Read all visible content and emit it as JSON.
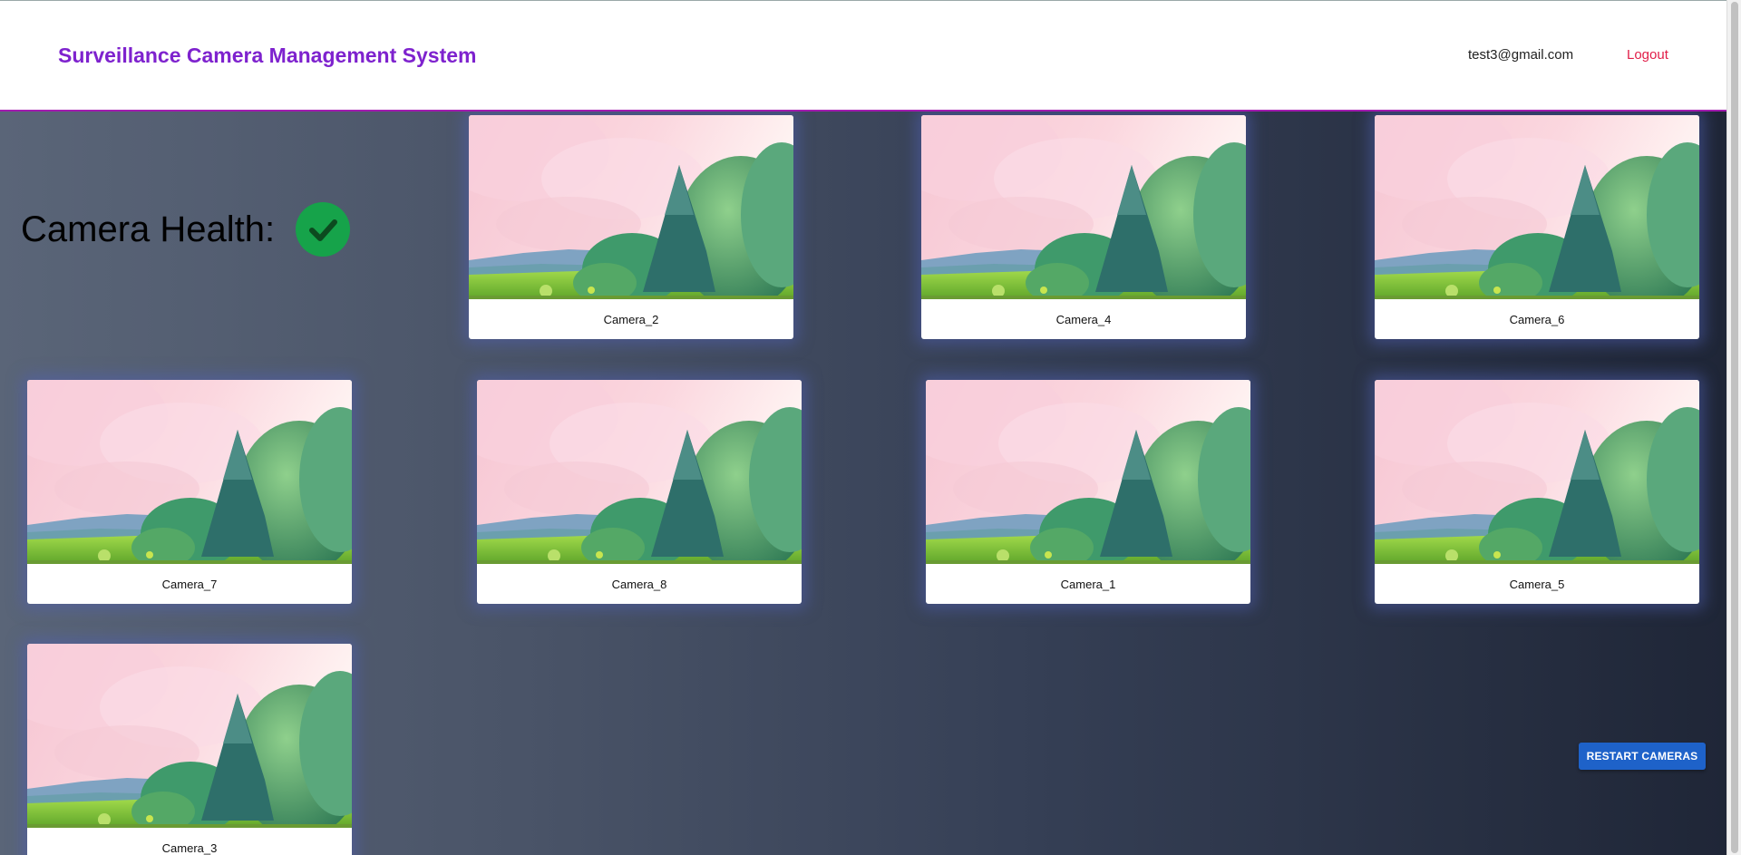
{
  "header": {
    "title": "Surveillance Camera Management System",
    "user_email": "test3@gmail.com",
    "logout_label": "Logout"
  },
  "health": {
    "label": "Camera Health:",
    "status_icon": "check-circle-icon",
    "status_color": "#16a34a"
  },
  "cameras": [
    {
      "name": "Camera_2"
    },
    {
      "name": "Camera_4"
    },
    {
      "name": "Camera_6"
    },
    {
      "name": "Camera_7"
    },
    {
      "name": "Camera_8"
    },
    {
      "name": "Camera_1"
    },
    {
      "name": "Camera_5"
    },
    {
      "name": "Camera_3"
    }
  ],
  "actions": {
    "restart_label": "RESTART CAMERAS"
  },
  "colors": {
    "brand": "#7e22ce",
    "logout": "#e11d48",
    "primary_button": "#1e62c9"
  }
}
